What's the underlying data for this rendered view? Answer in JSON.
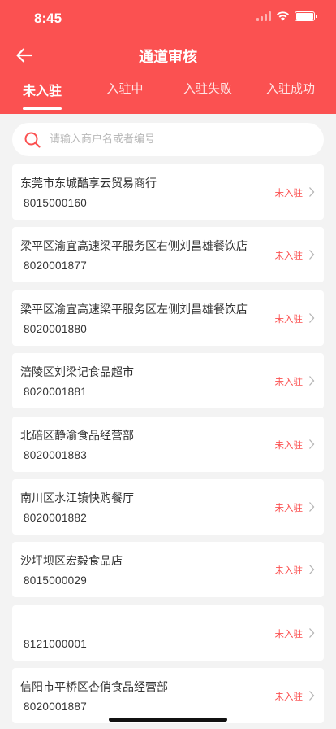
{
  "status_bar": {
    "time": "8:45"
  },
  "nav": {
    "title": "通道审核"
  },
  "tabs": [
    {
      "label": "未入驻",
      "active": true
    },
    {
      "label": "入驻中",
      "active": false
    },
    {
      "label": "入驻失败",
      "active": false
    },
    {
      "label": "入驻成功",
      "active": false
    }
  ],
  "search": {
    "placeholder": "请输入商户名或者编号"
  },
  "merchants": [
    {
      "name": "东莞市东城酷享云贸易商行",
      "code": "8015000160",
      "status": "未入驻"
    },
    {
      "name": "梁平区渝宜高速梁平服务区右侧刘昌雄餐饮店",
      "code": "8020001877",
      "status": "未入驻"
    },
    {
      "name": "梁平区渝宜高速梁平服务区左侧刘昌雄餐饮店",
      "code": "8020001880",
      "status": "未入驻"
    },
    {
      "name": "涪陵区刘梁记食品超市",
      "code": "8020001881",
      "status": "未入驻"
    },
    {
      "name": "北碚区静渝食品经营部",
      "code": "8020001883",
      "status": "未入驻"
    },
    {
      "name": "南川区水江镇快购餐厅",
      "code": "8020001882",
      "status": "未入驻"
    },
    {
      "name": "沙坪坝区宏毅食品店",
      "code": "8015000029",
      "status": "未入驻"
    },
    {
      "name": "",
      "code": "8121000001",
      "status": "未入驻"
    },
    {
      "name": "信阳市平桥区杏俏食品经营部",
      "code": "8020001887",
      "status": "未入驻"
    }
  ],
  "colors": {
    "accent": "#fb5151",
    "background": "#f3f3f3"
  }
}
